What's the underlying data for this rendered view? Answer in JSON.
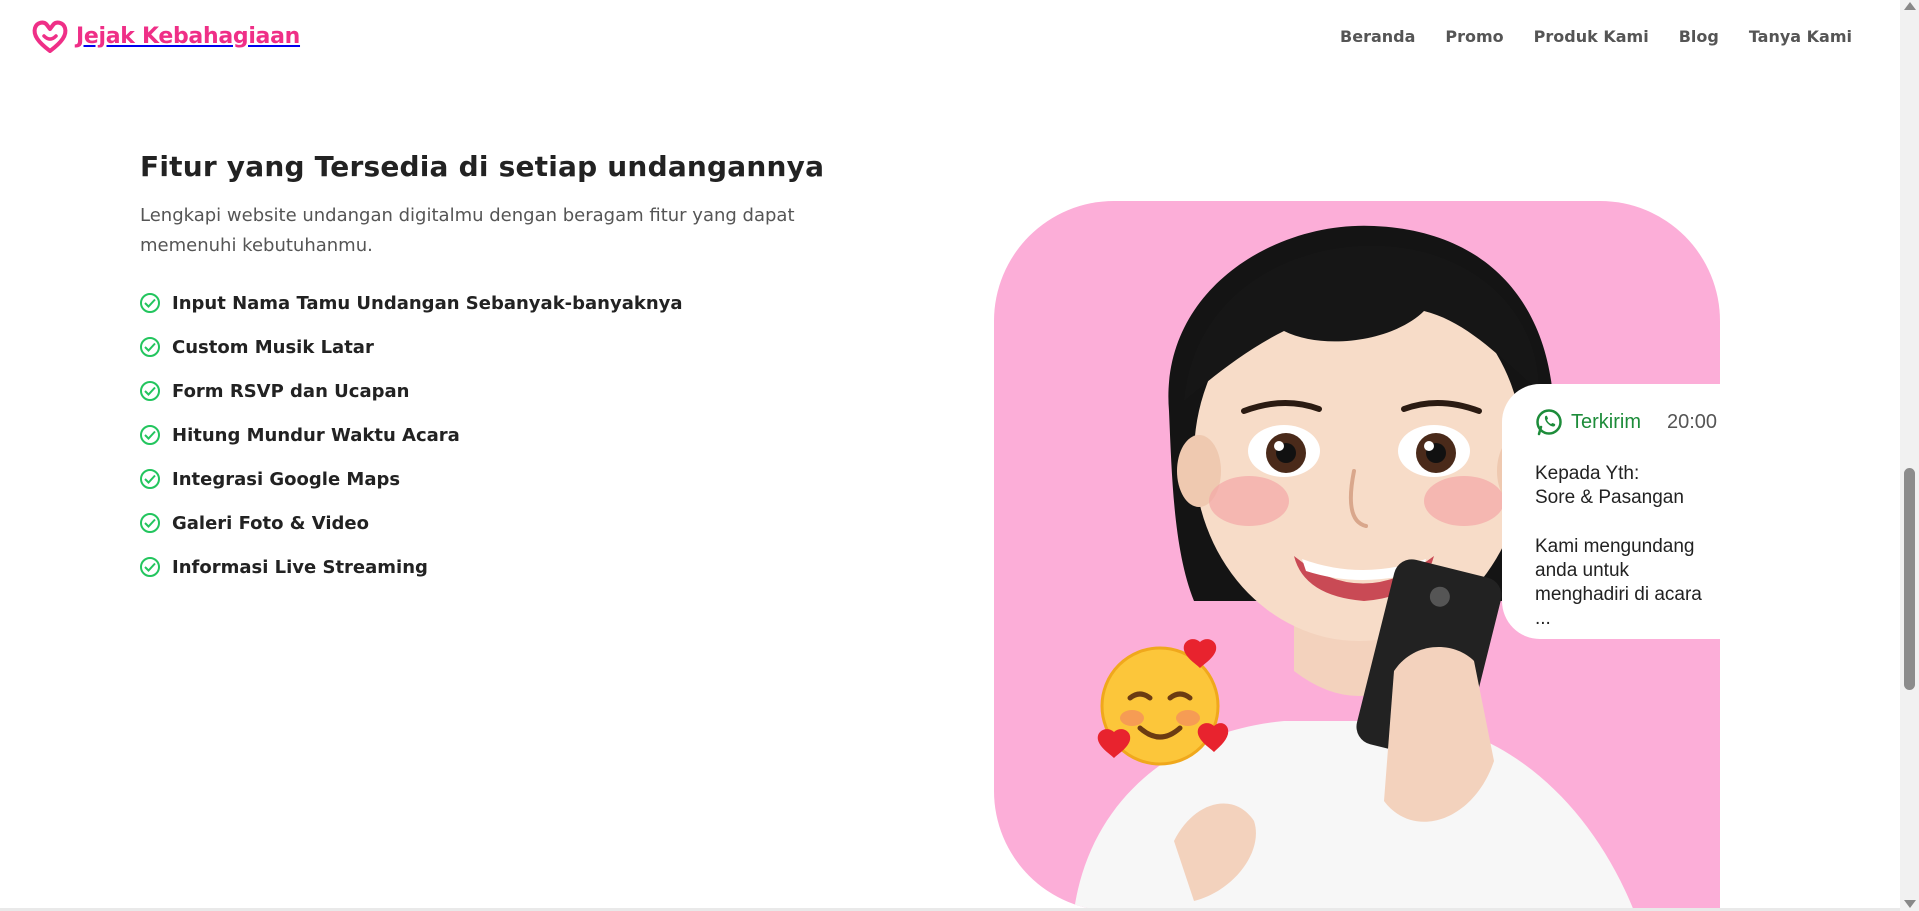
{
  "brand": {
    "name": "Jejak Kebahagiaan",
    "logo_icon": "heart-logo-icon",
    "color": "#ef2f87"
  },
  "nav": {
    "items": [
      {
        "label": "Beranda"
      },
      {
        "label": "Promo"
      },
      {
        "label": "Produk Kami"
      },
      {
        "label": "Blog"
      },
      {
        "label": "Tanya Kami"
      }
    ]
  },
  "features_section": {
    "title": "Fitur yang Tersedia di setiap undangannya",
    "subtitle_line1": "Lengkapi website undangan digitalmu dengan beragam fitur yang dapat",
    "subtitle_line2": "memenuhi kebutuhanmu.",
    "check_icon": "check-circle-icon",
    "check_color": "#23c55e",
    "items": [
      {
        "label": "Input Nama Tamu Undangan Sebanyak-banyaknya"
      },
      {
        "label": "Custom Musik Latar"
      },
      {
        "label": "Form RSVP dan Ucapan"
      },
      {
        "label": "Hitung Mundur Waktu Acara"
      },
      {
        "label": "Integrasi Google Maps"
      },
      {
        "label": "Galeri Foto & Video"
      },
      {
        "label": "Informasi Live Streaming"
      }
    ]
  },
  "visual": {
    "background_color": "#fcaed8",
    "chat_card": {
      "icon": "whatsapp-icon",
      "status": "Terkirim",
      "time": "20:00",
      "line1": "Kepada Yth:",
      "line2": "Sore & Pasangan",
      "line3": "Kami mengundang",
      "line4": "anda untuk",
      "line5": "menghadiri di acara ..."
    },
    "emoji": "smiling-face-with-hearts-emoji"
  }
}
